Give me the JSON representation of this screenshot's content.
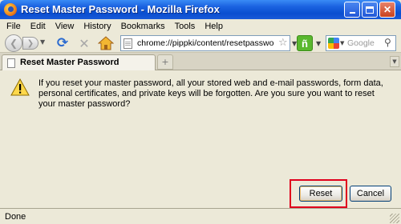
{
  "window": {
    "title": "Reset Master Password - Mozilla Firefox",
    "app_icon": "firefox-icon",
    "controls": {
      "minimize": "minimize-icon",
      "maximize": "maximize-icon",
      "close_label": "✕"
    }
  },
  "menubar": {
    "items": [
      {
        "label": "File"
      },
      {
        "label": "Edit"
      },
      {
        "label": "View"
      },
      {
        "label": "History"
      },
      {
        "label": "Bookmarks"
      },
      {
        "label": "Tools"
      },
      {
        "label": "Help"
      }
    ]
  },
  "navbar": {
    "back_icon": "back-arrow-icon",
    "forward_icon": "forward-arrow-icon",
    "reload_icon": "reload-icon",
    "stop_icon": "stop-icon",
    "home_icon": "home-icon",
    "url": "chrome://pippki/content/resetpassword.xul",
    "bookmark_star": "☆",
    "extension_label": "ñ",
    "search": {
      "placeholder": "Google",
      "engine_icon": "google-icon"
    }
  },
  "tabs": {
    "items": [
      {
        "label": "Reset Master Password",
        "active": true
      }
    ],
    "new_tab_label": "+"
  },
  "dialog": {
    "icon": "warning-icon",
    "message": "If you reset your master password, all your stored web and e-mail passwords, form data, personal certificates, and private keys will be forgotten. Are you sure you want to reset your master password?",
    "reset_label": "Reset",
    "cancel_label": "Cancel",
    "highlight_color": "#e0001c"
  },
  "statusbar": {
    "text": "Done"
  },
  "colors": {
    "titlebar": "#0a4ed0",
    "chrome": "#ece9d8",
    "reload": "#2a6ad0"
  }
}
